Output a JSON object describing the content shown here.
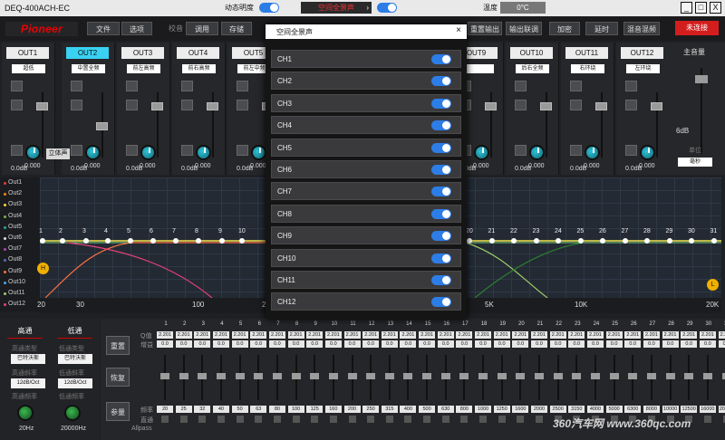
{
  "window": {
    "title": "DEQ-400ACH-EC",
    "brightness_label": "动态明度",
    "preset_label": "空间全景声",
    "temp_label": "温度",
    "temp_value": "0°C",
    "win_btns": [
      "_",
      "□",
      "X"
    ]
  },
  "toolbar": {
    "logo": "Pioneer",
    "file": "文件",
    "options": "选项",
    "tune_label": "校音",
    "tune": "调用",
    "save": "存储",
    "reset_output": "重置输出",
    "output_link": "输出联调",
    "encrypt": "加密",
    "delay": "延时",
    "mix": "混音混频",
    "connect": "未连接"
  },
  "channels": [
    {
      "name": "OUT1",
      "type": "超低",
      "db": "0.0dB",
      "knob": "0.000"
    },
    {
      "name": "OUT2",
      "type": "中置全频",
      "db": "0.0dB",
      "knob": "0.000"
    },
    {
      "name": "OUT3",
      "type": "前左高频",
      "db": "0.0dB",
      "knob": "0.000"
    },
    {
      "name": "OUT4",
      "type": "前右高频",
      "db": "0.0dB",
      "knob": "0.000"
    },
    {
      "name": "OUT5",
      "type": "前左中频",
      "db": "0.0dB",
      "knob": "0.000"
    },
    {
      "name": "OUT9",
      "type": "",
      "db": "0.0dB",
      "knob": "0.000"
    },
    {
      "name": "OUT10",
      "type": "后右全频",
      "db": "0.0dB",
      "knob": "0.000"
    },
    {
      "name": "OUT11",
      "type": "右环绕",
      "db": "0.0dB",
      "knob": "0.000"
    },
    {
      "name": "OUT12",
      "type": "左环绕",
      "db": "0.0dB",
      "knob": "0.000"
    }
  ],
  "stereo_label": "立体声",
  "master": {
    "label": "主音量",
    "db": "6dB",
    "unit_label": "单位",
    "unit": "毫秒"
  },
  "legend": [
    "Out1",
    "Out2",
    "Out3",
    "Out4",
    "Out5",
    "Out6",
    "Out7",
    "Out8",
    "Out9",
    "Out10",
    "Out11",
    "Out12"
  ],
  "legend_colors": [
    "#e53935",
    "#fb8c00",
    "#fdd835",
    "#7cb342",
    "#26a69a",
    "#e0e0e0",
    "#ab47bc",
    "#5c6bc0",
    "#ff7043",
    "#42a5f5",
    "#9ccc65",
    "#ec407a"
  ],
  "graph": {
    "x_ticks": [
      "20",
      "30",
      "100",
      "2K",
      "5K",
      "10K",
      "20K"
    ],
    "points_left": [
      "1",
      "2",
      "3",
      "4",
      "5",
      "6",
      "7",
      "8",
      "9",
      "10"
    ],
    "points_right": [
      "20",
      "21",
      "22",
      "23",
      "24",
      "25",
      "26",
      "27",
      "28",
      "29",
      "30",
      "31"
    ],
    "marker_left": "H",
    "marker_right": "L"
  },
  "popup": {
    "title": "空间全景声",
    "close": "×",
    "channels": [
      "CH1",
      "CH2",
      "CH3",
      "CH4",
      "CH5",
      "CH6",
      "CH7",
      "CH8",
      "CH9",
      "CH10",
      "CH11",
      "CH12"
    ]
  },
  "hl": {
    "tab_high": "高通",
    "tab_low": "低通",
    "type_high_label": "高通类型",
    "type_low_label": "低通类型",
    "type_high": "巴特沃斯",
    "type_low": "巴特沃斯",
    "slope_high_label": "高通斜率",
    "slope_low_label": "低通斜率",
    "slope_high": "12dB/Oct",
    "slope_low": "12dB/Oct",
    "freq_high_label": "高通频率",
    "freq_low_label": "低通频率",
    "freq_high": "20Hz",
    "freq_low": "20000Hz"
  },
  "eq": {
    "reset": "重置",
    "restore": "恢复",
    "params": "参量",
    "q_label": "Q值",
    "gain_label": "增益",
    "freq_label": "频率",
    "straight_label": "直通",
    "allpass_label": "Allpass",
    "bands": [
      "1",
      "2",
      "3",
      "4",
      "5",
      "6",
      "7",
      "8",
      "9",
      "10",
      "11",
      "12",
      "13",
      "14",
      "15",
      "16",
      "17",
      "18",
      "19",
      "20",
      "21",
      "22",
      "23",
      "24",
      "25",
      "26",
      "27",
      "28",
      "29",
      "30",
      "31"
    ],
    "q": "2.201",
    "gain": "0.0",
    "freqs": [
      "20",
      "25",
      "32",
      "40",
      "50",
      "63",
      "80",
      "100",
      "125",
      "160",
      "200",
      "250",
      "315",
      "400",
      "500",
      "630",
      "800",
      "1000",
      "1250",
      "1600",
      "2000",
      "2500",
      "3150",
      "4000",
      "5000",
      "6300",
      "8000",
      "10000",
      "12500",
      "16000",
      "20000"
    ]
  },
  "watermark": "360汽车网 www.360qc.com"
}
